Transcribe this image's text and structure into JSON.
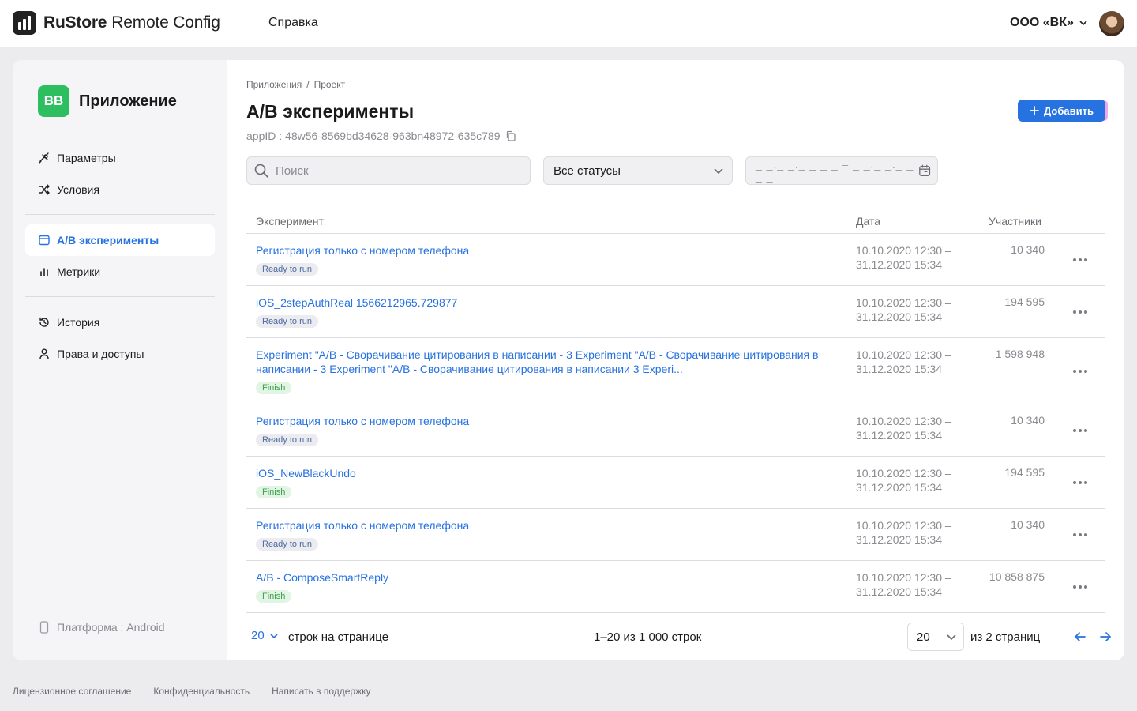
{
  "header": {
    "logo_brand": "RuStore",
    "logo_product": "Remote Config",
    "help_link": "Справка",
    "org_name": "ООО «ВК»"
  },
  "sidebar": {
    "app_icon_text": "BB",
    "app_title": "Приложение",
    "items": [
      {
        "label": "Параметры",
        "icon": "sliders-icon"
      },
      {
        "label": "Условия",
        "icon": "shuffle-icon"
      },
      {
        "label": "A/B эксперименты",
        "icon": "window-icon",
        "active": true
      },
      {
        "label": "Метрики",
        "icon": "bar-chart-icon"
      },
      {
        "label": "История",
        "icon": "history-icon"
      },
      {
        "label": "Права и доступы",
        "icon": "user-icon"
      }
    ],
    "platform": "Платформа : Android"
  },
  "main": {
    "breadcrumb": [
      "Приложения",
      "/",
      "Проект"
    ],
    "title": "A/B эксперименты",
    "appid": "appID : 48w56-8569bd34628-963bn48972-635c789",
    "add_button": "Добавить",
    "search_placeholder": "Поиск",
    "status_select": "Все статусы",
    "date_placeholder": "_ _._ _._ _ _ _  –  _ _._ _._ _ _ _",
    "columns": {
      "experiment": "Эксперимент",
      "date": "Дата",
      "participants": "Участники"
    },
    "rows": [
      {
        "name": "Регистрация только с номером телефона",
        "status": "Ready to run",
        "date_start": "10.10.2020 12:30 –",
        "date_end": "31.12.2020 15:34",
        "participants": "10 340"
      },
      {
        "name": "iOS_2stepAuthReal 1566212965.729877",
        "status": "Ready to run",
        "date_start": "10.10.2020 12:30 –",
        "date_end": "31.12.2020 15:34",
        "participants": "194 595"
      },
      {
        "name": "Experiment \"A/B - Сворачивание цитирования в написании - 3 Experiment \"A/B - Сворачивание цитирования в написании - 3 Experiment \"A/B - Сворачивание  цитирования в написании 3 Experi...",
        "status": "Finish",
        "date_start": "10.10.2020 12:30 –",
        "date_end": "31.12.2020 15:34",
        "participants": "1 598 948"
      },
      {
        "name": "Регистрация только с номером телефона",
        "status": "Ready to run",
        "date_start": "10.10.2020 12:30 –",
        "date_end": "31.12.2020 15:34",
        "participants": "10 340"
      },
      {
        "name": "iOS_NewBlackUndo",
        "status": "Finish",
        "date_start": "10.10.2020 12:30 –",
        "date_end": "31.12.2020 15:34",
        "participants": "194 595"
      },
      {
        "name": "Регистрация только с номером телефона",
        "status": "Ready to run",
        "date_start": "10.10.2020 12:30 –",
        "date_end": "31.12.2020 15:34",
        "participants": "10 340"
      },
      {
        "name": "A/B - ComposeSmartReply",
        "status": "Finish",
        "date_start": "10.10.2020 12:30 –",
        "date_end": "31.12.2020 15:34",
        "participants": "10 858 875"
      }
    ],
    "pagination": {
      "per_page_value": "20",
      "per_page_label": "строк на странице",
      "range": "1–20 из 1 000 строк",
      "page_value": "20",
      "of_pages": "из 2 страниц"
    }
  },
  "footer": {
    "links": [
      "Лицензионное соглашение",
      "Конфиденциальность",
      "Написать в поддержку"
    ]
  },
  "colors": {
    "accent": "#2672e0",
    "brand_green": "#2dbf5f",
    "finish_green": "#37a24a"
  }
}
